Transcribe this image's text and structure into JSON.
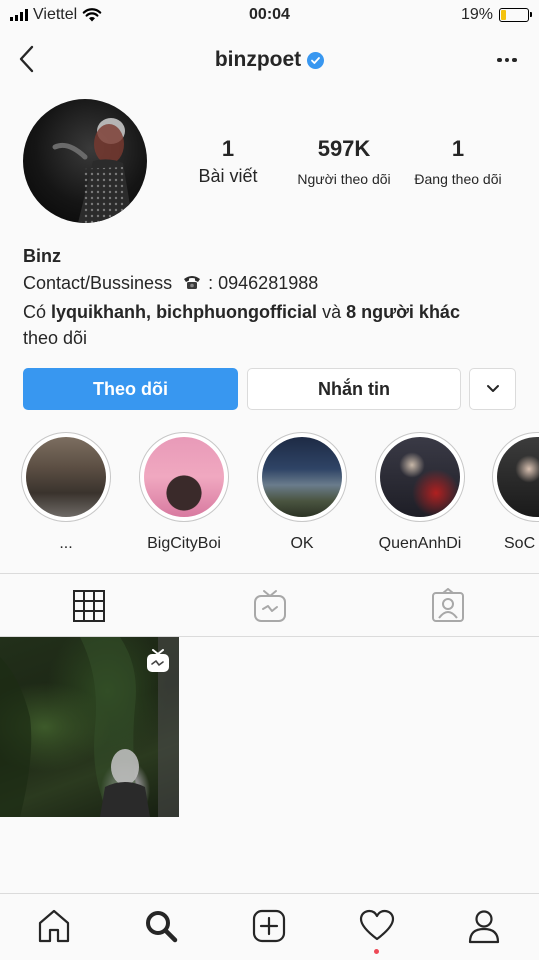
{
  "status_bar": {
    "carrier": "Viettel",
    "time": "00:04",
    "battery_percent": "19%",
    "battery_level": 0.19,
    "battery_color": "#f4c20d"
  },
  "header": {
    "username": "binzpoet",
    "verified": true,
    "back_icon": "chevron-left-icon",
    "more_icon": "more-horizontal-icon"
  },
  "profile": {
    "stats": [
      {
        "value": "1",
        "label": "Bài viết"
      },
      {
        "value": "597K",
        "label": "Người theo dõi"
      },
      {
        "value": "1",
        "label": "Đang theo dõi"
      }
    ],
    "name": "Binz",
    "contact_label": "Contact/Bussiness",
    "contact_sep": ":",
    "phone": "0946281988",
    "followed_by": {
      "prefix": "Có",
      "user1": "lyquikhanh,",
      "user2": "bichphuongofficial",
      "connector": "và",
      "others": "8 người khác",
      "suffix": "theo dõi"
    }
  },
  "actions": {
    "follow": "Theo dõi",
    "message": "Nhắn tin",
    "accent_color": "#3897f0"
  },
  "highlights": [
    {
      "label": "..."
    },
    {
      "label": "BigCityBoi"
    },
    {
      "label": "OK"
    },
    {
      "label": "QuenAnhDi"
    },
    {
      "label": "SoC"
    }
  ],
  "tabs": [
    {
      "icon": "grid-icon",
      "active": true
    },
    {
      "icon": "igtv-icon",
      "active": false
    },
    {
      "icon": "tagged-icon",
      "active": false
    }
  ],
  "posts": [
    {
      "type": "igtv"
    }
  ],
  "bottom_nav": [
    {
      "icon": "home-icon"
    },
    {
      "icon": "search-icon",
      "active": true
    },
    {
      "icon": "add-post-icon"
    },
    {
      "icon": "activity-heart-icon",
      "notification_dot": true
    },
    {
      "icon": "profile-icon"
    }
  ],
  "notification_dot_color": "#ed4956"
}
